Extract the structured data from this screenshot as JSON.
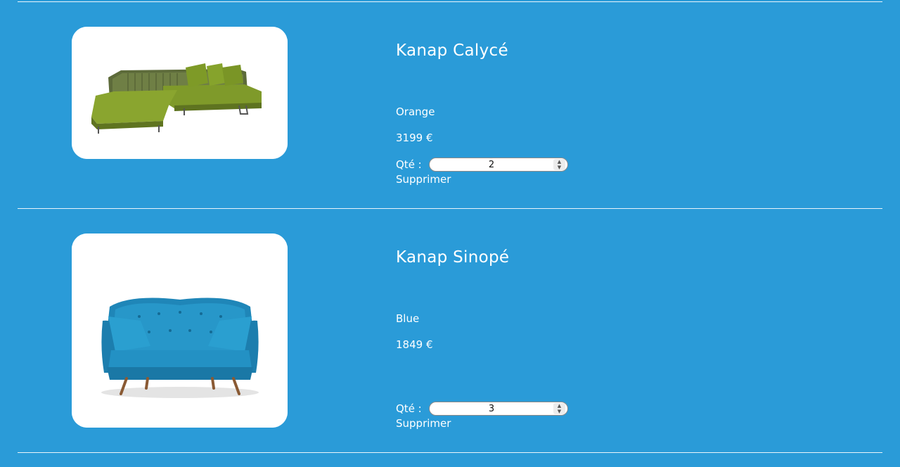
{
  "cart": {
    "items": [
      {
        "name": "Kanap Calycé",
        "color": "Orange",
        "price": "3199 €",
        "qty_label": "Qté :",
        "quantity": "2",
        "delete_label": "Supprimer",
        "image": "green-corner-sofa"
      },
      {
        "name": "Kanap Sinopé",
        "color": "Blue",
        "price": "1849 €",
        "qty_label": "Qté :",
        "quantity": "3",
        "delete_label": "Supprimer",
        "image": "blue-loveseat-sofa"
      }
    ]
  },
  "colors": {
    "background": "#2a9bd8",
    "text": "#ffffff",
    "card": "#ffffff"
  }
}
